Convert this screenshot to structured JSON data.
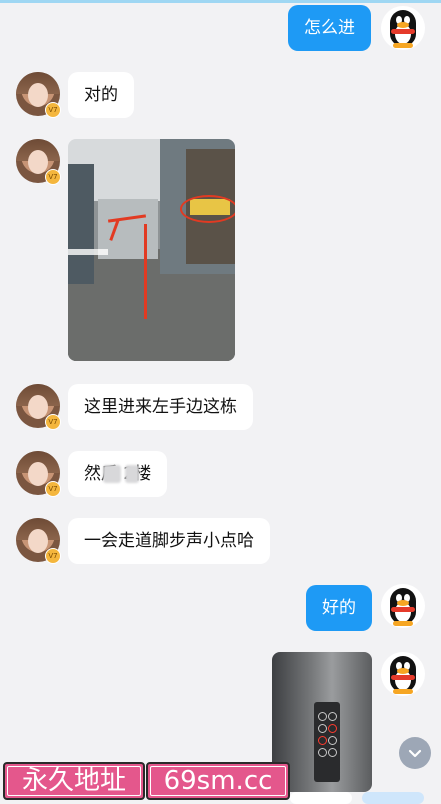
{
  "messages": [
    {
      "from": "me",
      "text": "怎么进"
    },
    {
      "from": "them",
      "text": "对的",
      "badge": "V7"
    },
    {
      "from": "them",
      "type": "image",
      "badge": "V7"
    },
    {
      "from": "them",
      "text": "这里进来左手边这栋",
      "badge": "V7"
    },
    {
      "from": "them",
      "text": "然后  2楼",
      "badge": "V7"
    },
    {
      "from": "them",
      "text": "一会走道脚步声小点哈",
      "badge": "V7"
    },
    {
      "from": "me",
      "text": "好的"
    },
    {
      "from": "me",
      "type": "image"
    }
  ],
  "scroll_down_icon": "chevron-down-icon",
  "watermark": {
    "left_text": "永久地址",
    "right_text": "69sm.cc",
    "color": "#e4578c"
  },
  "colors": {
    "outgoing_bubble": "#1e9af5",
    "incoming_bubble": "#ffffff",
    "background": "#f2f2f4"
  }
}
